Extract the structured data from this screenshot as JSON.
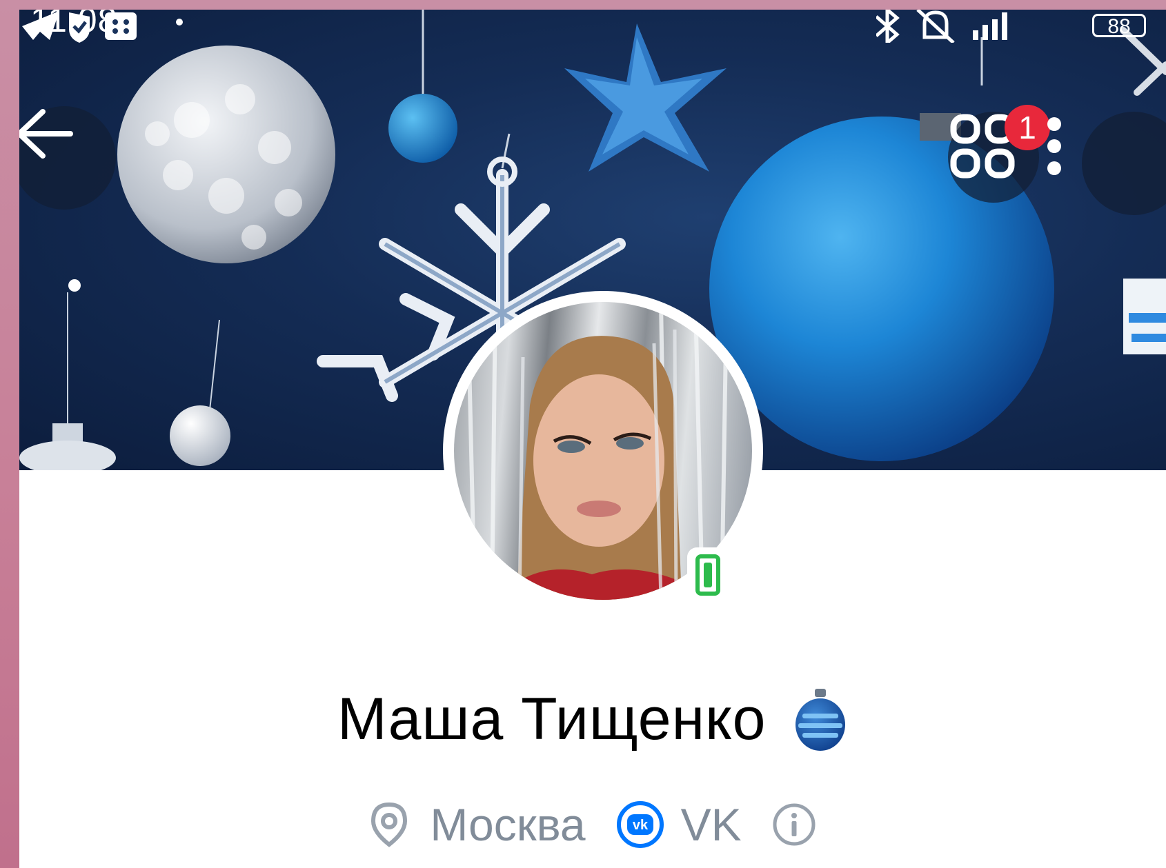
{
  "status_bar": {
    "time": "11:08",
    "battery": "88",
    "left_icons": [
      "telegram-icon",
      "shield-check-icon",
      "grid-app-icon",
      "dot-icon"
    ],
    "right_icons": [
      "bluetooth-icon",
      "mute-icon",
      "signal-icon"
    ]
  },
  "header": {
    "back_icon": "arrow-left-icon",
    "apps_icon": "apps-grid-icon",
    "apps_badge": "1",
    "menu_icon": "more-vertical-icon"
  },
  "profile": {
    "name": "Маша Тищенко",
    "name_badge_icon": "christmas-ornament-icon",
    "online_status_icon": "mobile-online-icon",
    "location_icon": "map-pin-icon",
    "location": "Москва",
    "network_icon": "vk-logo-icon",
    "network": "VK",
    "info_icon": "info-icon"
  },
  "colors": {
    "cover_dark": "#0c1d3d",
    "ornament_blue": "#1e7fd0",
    "badge_red": "#e8283b",
    "online_green": "#2dbb4c",
    "vk_blue": "#0077ff",
    "secondary_text": "#818c99"
  }
}
